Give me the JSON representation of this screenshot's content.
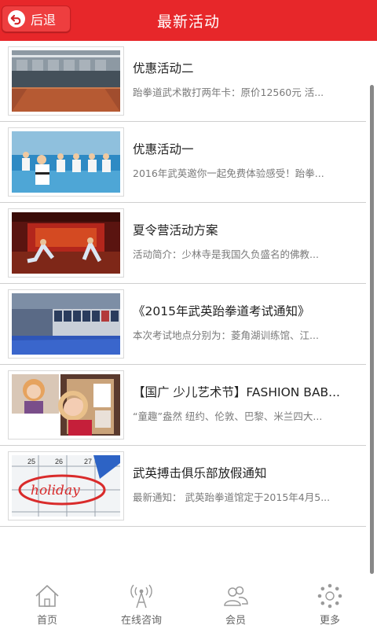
{
  "header": {
    "back_label": "后退",
    "title": "最新活动"
  },
  "activities": [
    {
      "title": "优惠活动二",
      "desc": "跆拳道武术散打两年卡：原价12560元 活...",
      "image": "dojo-hall-photo"
    },
    {
      "title": "优惠活动一",
      "desc": "2016年武英邀你一起免费体验感受！跆拳...",
      "image": "kids-taekwondo-class-photo"
    },
    {
      "title": "夏令营活动方案",
      "desc": "活动简介：少林寺是我国久负盛名的佛教...",
      "image": "shaolin-performance-photo"
    },
    {
      "title": "《2015年武英跆拳道考试通知》",
      "desc": "本次考试地点分别为：菱角湖训练馆、江...",
      "image": "training-hall-lockers-photo"
    },
    {
      "title": "【国广 少儿艺术节】FASHION BAB...",
      "desc": "“童趣”盎然 纽约、伦敦、巴黎、米兰四大...",
      "image": "fashion-kids-photo"
    },
    {
      "title": "武英搏击俱乐部放假通知",
      "desc": "最新通知：  武英跆拳道馆定于2015年4月5...",
      "image": "holiday-calendar-photo",
      "image_text": "holiday"
    }
  ],
  "tabbar": {
    "tabs": [
      {
        "label": "首页",
        "icon": "home-icon"
      },
      {
        "label": "在线咨询",
        "icon": "antenna-icon"
      },
      {
        "label": "会员",
        "icon": "members-icon"
      },
      {
        "label": "更多",
        "icon": "more-icon"
      }
    ]
  },
  "colors": {
    "header": "#e7272a",
    "back_button": "#ee3e3f",
    "title_text": "#222222",
    "desc_text": "#7a7a7a",
    "tab_icon": "#9a9a9a"
  }
}
